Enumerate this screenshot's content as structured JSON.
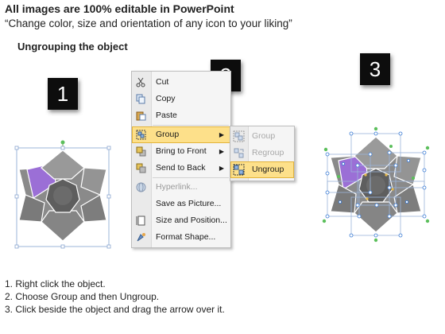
{
  "header": {
    "title": "All images are 100% editable in PowerPoint",
    "subtitle": "“Change color, size and orientation of any icon to your liking”"
  },
  "section_title": "Ungrouping the object",
  "steps": [
    "1",
    "2",
    "3"
  ],
  "context_menu": {
    "items": [
      {
        "label": "Cut",
        "icon": "scissors-icon"
      },
      {
        "label": "Copy",
        "icon": "copy-icon"
      },
      {
        "label": "Paste",
        "icon": "paste-icon"
      },
      {
        "label": "Group",
        "icon": "group-icon",
        "highlighted": true,
        "submenu": true
      },
      {
        "label": "Bring to Front",
        "icon": "bring-front-icon",
        "submenu": true
      },
      {
        "label": "Send to Back",
        "icon": "send-back-icon",
        "submenu": true
      },
      {
        "label": "Hyperlink...",
        "icon": "globe-icon",
        "disabled": true
      },
      {
        "label": "Save as Picture...",
        "icon": ""
      },
      {
        "label": "Size and Position...",
        "icon": "size-position-icon"
      },
      {
        "label": "Format Shape...",
        "icon": "format-shape-icon"
      }
    ]
  },
  "submenu": {
    "items": [
      {
        "label": "Group",
        "icon": "group-icon",
        "disabled": true
      },
      {
        "label": "Regroup",
        "icon": "regroup-icon",
        "disabled": true
      },
      {
        "label": "Ungroup",
        "icon": "ungroup-icon",
        "highlighted": true
      }
    ]
  },
  "instructions": [
    "1.  Right click the object.",
    "2.  Choose Group and then Ungroup.",
    "3.  Click beside the object and drag the arrow over it."
  ],
  "colors": {
    "shape_gray": "#8a8a8a",
    "shape_dark": "#5e5e5e",
    "accent_purple": "#9b6fd6",
    "menu_highlight": "#fde08a",
    "handle_green": "#4caf50",
    "handle_blue": "#3a7bd5"
  }
}
